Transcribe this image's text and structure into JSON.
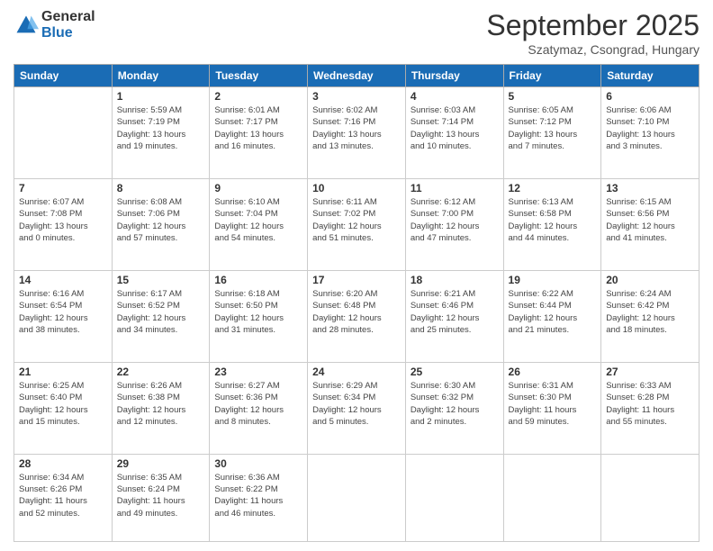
{
  "logo": {
    "general": "General",
    "blue": "Blue"
  },
  "header": {
    "month": "September 2025",
    "location": "Szatymaz, Csongrad, Hungary"
  },
  "weekdays": [
    "Sunday",
    "Monday",
    "Tuesday",
    "Wednesday",
    "Thursday",
    "Friday",
    "Saturday"
  ],
  "weeks": [
    [
      {
        "day": "",
        "info": ""
      },
      {
        "day": "1",
        "info": "Sunrise: 5:59 AM\nSunset: 7:19 PM\nDaylight: 13 hours\nand 19 minutes."
      },
      {
        "day": "2",
        "info": "Sunrise: 6:01 AM\nSunset: 7:17 PM\nDaylight: 13 hours\nand 16 minutes."
      },
      {
        "day": "3",
        "info": "Sunrise: 6:02 AM\nSunset: 7:16 PM\nDaylight: 13 hours\nand 13 minutes."
      },
      {
        "day": "4",
        "info": "Sunrise: 6:03 AM\nSunset: 7:14 PM\nDaylight: 13 hours\nand 10 minutes."
      },
      {
        "day": "5",
        "info": "Sunrise: 6:05 AM\nSunset: 7:12 PM\nDaylight: 13 hours\nand 7 minutes."
      },
      {
        "day": "6",
        "info": "Sunrise: 6:06 AM\nSunset: 7:10 PM\nDaylight: 13 hours\nand 3 minutes."
      }
    ],
    [
      {
        "day": "7",
        "info": "Sunrise: 6:07 AM\nSunset: 7:08 PM\nDaylight: 13 hours\nand 0 minutes."
      },
      {
        "day": "8",
        "info": "Sunrise: 6:08 AM\nSunset: 7:06 PM\nDaylight: 12 hours\nand 57 minutes."
      },
      {
        "day": "9",
        "info": "Sunrise: 6:10 AM\nSunset: 7:04 PM\nDaylight: 12 hours\nand 54 minutes."
      },
      {
        "day": "10",
        "info": "Sunrise: 6:11 AM\nSunset: 7:02 PM\nDaylight: 12 hours\nand 51 minutes."
      },
      {
        "day": "11",
        "info": "Sunrise: 6:12 AM\nSunset: 7:00 PM\nDaylight: 12 hours\nand 47 minutes."
      },
      {
        "day": "12",
        "info": "Sunrise: 6:13 AM\nSunset: 6:58 PM\nDaylight: 12 hours\nand 44 minutes."
      },
      {
        "day": "13",
        "info": "Sunrise: 6:15 AM\nSunset: 6:56 PM\nDaylight: 12 hours\nand 41 minutes."
      }
    ],
    [
      {
        "day": "14",
        "info": "Sunrise: 6:16 AM\nSunset: 6:54 PM\nDaylight: 12 hours\nand 38 minutes."
      },
      {
        "day": "15",
        "info": "Sunrise: 6:17 AM\nSunset: 6:52 PM\nDaylight: 12 hours\nand 34 minutes."
      },
      {
        "day": "16",
        "info": "Sunrise: 6:18 AM\nSunset: 6:50 PM\nDaylight: 12 hours\nand 31 minutes."
      },
      {
        "day": "17",
        "info": "Sunrise: 6:20 AM\nSunset: 6:48 PM\nDaylight: 12 hours\nand 28 minutes."
      },
      {
        "day": "18",
        "info": "Sunrise: 6:21 AM\nSunset: 6:46 PM\nDaylight: 12 hours\nand 25 minutes."
      },
      {
        "day": "19",
        "info": "Sunrise: 6:22 AM\nSunset: 6:44 PM\nDaylight: 12 hours\nand 21 minutes."
      },
      {
        "day": "20",
        "info": "Sunrise: 6:24 AM\nSunset: 6:42 PM\nDaylight: 12 hours\nand 18 minutes."
      }
    ],
    [
      {
        "day": "21",
        "info": "Sunrise: 6:25 AM\nSunset: 6:40 PM\nDaylight: 12 hours\nand 15 minutes."
      },
      {
        "day": "22",
        "info": "Sunrise: 6:26 AM\nSunset: 6:38 PM\nDaylight: 12 hours\nand 12 minutes."
      },
      {
        "day": "23",
        "info": "Sunrise: 6:27 AM\nSunset: 6:36 PM\nDaylight: 12 hours\nand 8 minutes."
      },
      {
        "day": "24",
        "info": "Sunrise: 6:29 AM\nSunset: 6:34 PM\nDaylight: 12 hours\nand 5 minutes."
      },
      {
        "day": "25",
        "info": "Sunrise: 6:30 AM\nSunset: 6:32 PM\nDaylight: 12 hours\nand 2 minutes."
      },
      {
        "day": "26",
        "info": "Sunrise: 6:31 AM\nSunset: 6:30 PM\nDaylight: 11 hours\nand 59 minutes."
      },
      {
        "day": "27",
        "info": "Sunrise: 6:33 AM\nSunset: 6:28 PM\nDaylight: 11 hours\nand 55 minutes."
      }
    ],
    [
      {
        "day": "28",
        "info": "Sunrise: 6:34 AM\nSunset: 6:26 PM\nDaylight: 11 hours\nand 52 minutes."
      },
      {
        "day": "29",
        "info": "Sunrise: 6:35 AM\nSunset: 6:24 PM\nDaylight: 11 hours\nand 49 minutes."
      },
      {
        "day": "30",
        "info": "Sunrise: 6:36 AM\nSunset: 6:22 PM\nDaylight: 11 hours\nand 46 minutes."
      },
      {
        "day": "",
        "info": ""
      },
      {
        "day": "",
        "info": ""
      },
      {
        "day": "",
        "info": ""
      },
      {
        "day": "",
        "info": ""
      }
    ]
  ]
}
